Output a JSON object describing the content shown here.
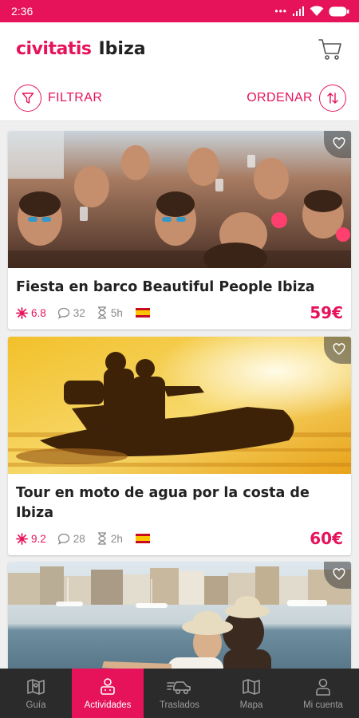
{
  "status": {
    "time": "2:36"
  },
  "header": {
    "brand": "civitatis",
    "city": "Ibiza",
    "cart_icon": "cart-icon"
  },
  "toolbar": {
    "filter_label": "FILTRAR",
    "sort_label": "ORDENAR"
  },
  "colors": {
    "accent": "#e6135b",
    "nav_bg": "#2b2b2b",
    "muted": "#8a8a8a"
  },
  "cards": [
    {
      "title": "Fiesta en barco Beautiful People Ibiza",
      "rating": "6.8",
      "comments": "32",
      "duration": "5h",
      "language": "spanish-flag",
      "price": "59€"
    },
    {
      "title": "Tour en moto de agua por la costa de Ibiza",
      "rating": "9.2",
      "comments": "28",
      "duration": "2h",
      "language": "spanish-flag",
      "price": "60€"
    },
    {
      "title": "",
      "rating": "",
      "comments": "",
      "duration": "",
      "language": "",
      "price": ""
    }
  ],
  "nav": [
    {
      "label": "Guía",
      "icon": "map-book-icon",
      "active": false
    },
    {
      "label": "Actividades",
      "icon": "activities-icon",
      "active": true
    },
    {
      "label": "Traslados",
      "icon": "transfer-car-icon",
      "active": false
    },
    {
      "label": "Mapa",
      "icon": "map-icon",
      "active": false
    },
    {
      "label": "Mi cuenta",
      "icon": "user-icon",
      "active": false
    }
  ]
}
